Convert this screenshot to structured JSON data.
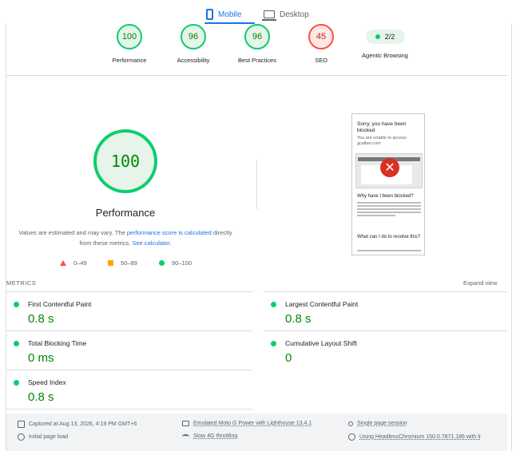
{
  "tabs": [
    {
      "label": "Mobile",
      "active": true,
      "icon": "phone-icon"
    },
    {
      "label": "Desktop",
      "active": false,
      "icon": "laptop-icon"
    }
  ],
  "gauges": [
    {
      "score": "100",
      "label": "Performance",
      "status": "pass"
    },
    {
      "score": "96",
      "label": "Accessibility",
      "status": "pass"
    },
    {
      "score": "96",
      "label": "Best Practices",
      "status": "pass"
    },
    {
      "score": "45",
      "label": "SEO",
      "status": "fail"
    }
  ],
  "agentic": {
    "value": "2/2",
    "label": "Agentic Browsing"
  },
  "performance": {
    "score": "100",
    "title": "Performance",
    "desc_part1": "Values are estimated and may vary. The ",
    "desc_link1": "performance score is calculated",
    "desc_part2": " directly from these metrics. ",
    "desc_link2": "See calculator."
  },
  "legend": {
    "fail": "0–49",
    "average": "50–89",
    "pass": "90–100"
  },
  "screenshot": {
    "heading": "Sorry, you have been blocked",
    "subheading": "You are unable to access gcalbet.com",
    "section1": "Why have I been blocked?",
    "section2": "What can I do to resolve this?"
  },
  "metrics": {
    "heading": "METRICS",
    "expand_label": "Expand view",
    "items": [
      {
        "label": "First Contentful Paint",
        "value": "0.8 s"
      },
      {
        "label": "Largest Contentful Paint",
        "value": "0.8 s"
      },
      {
        "label": "Total Blocking Time",
        "value": "0 ms"
      },
      {
        "label": "Cumulative Layout Shift",
        "value": "0"
      },
      {
        "label": "Speed Index",
        "value": "0.8 s"
      }
    ]
  },
  "footer": {
    "captured": "Captured at Aug 13, 2026, 4:19 PM GMT+6",
    "initial_load": "Initial page load",
    "device": "Emulated Moto G Power with Lighthouse 13.4.1",
    "throttling": "Slow 4G throttling",
    "session": "Single page session",
    "browser": "Using HeadlessChromium 150.0.7871.186 with lr"
  },
  "colors": {
    "pass": "#0cce6b",
    "fail": "#ff4e42",
    "average": "#ffa400",
    "accent": "#1a73e8"
  }
}
